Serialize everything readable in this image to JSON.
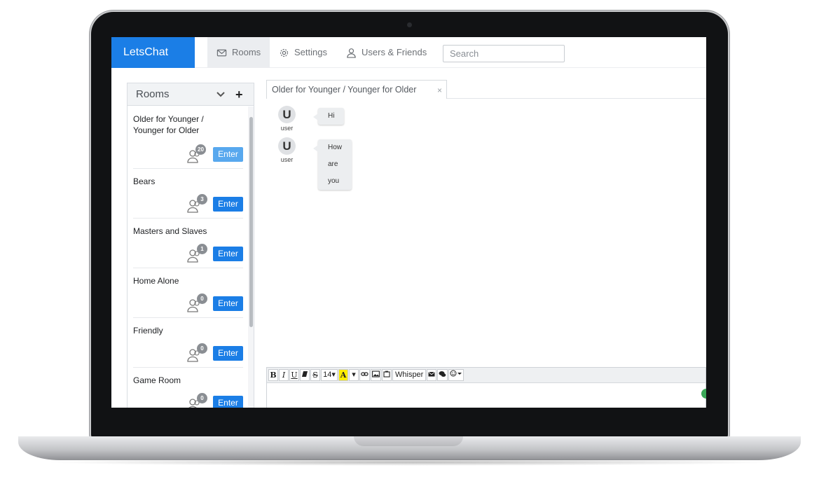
{
  "app": {
    "brand": "LetsChat"
  },
  "nav": {
    "rooms_label": "Rooms",
    "settings_label": "Settings",
    "users_label": "Users & Friends",
    "search_placeholder": "Search"
  },
  "rooms_panel": {
    "title": "Rooms",
    "add_symbol": "+",
    "rooms": [
      {
        "name": "Older for Younger / Younger for Older",
        "count": "20",
        "enter_label": "Enter"
      },
      {
        "name": "Bears",
        "count": "3",
        "enter_label": "Enter"
      },
      {
        "name": "Masters and Slaves",
        "count": "1",
        "enter_label": "Enter"
      },
      {
        "name": "Home Alone",
        "count": "0",
        "enter_label": "Enter"
      },
      {
        "name": "Friendly",
        "count": "0",
        "enter_label": "Enter"
      },
      {
        "name": "Game Room",
        "count": "0",
        "enter_label": "Enter"
      }
    ]
  },
  "chat": {
    "tab_title": "Older for Younger / Younger for Older",
    "tab_close": "×",
    "messages": [
      {
        "avatar_letter": "U",
        "user": "user",
        "text": "Hi"
      },
      {
        "avatar_letter": "U",
        "user": "user",
        "text": "How are you"
      }
    ]
  },
  "editor": {
    "bold": "B",
    "italic": "I",
    "underline": "U",
    "strike": "S",
    "font_size": "14▾",
    "highlight": "A",
    "caret": "▾",
    "whisper": "Whisper"
  },
  "colors": {
    "accent": "#1b7ee6",
    "accent_light": "#58a8ee",
    "badge": "#8a8e93"
  },
  "icons": [
    "envelope-icon",
    "gear-icon",
    "user-icon",
    "chevron-down-icon",
    "plus-icon",
    "users-icon",
    "eraser-icon",
    "link-icon",
    "image-icon",
    "video-icon",
    "envelope-icon",
    "chat-bubbles-icon",
    "smiley-icon"
  ]
}
